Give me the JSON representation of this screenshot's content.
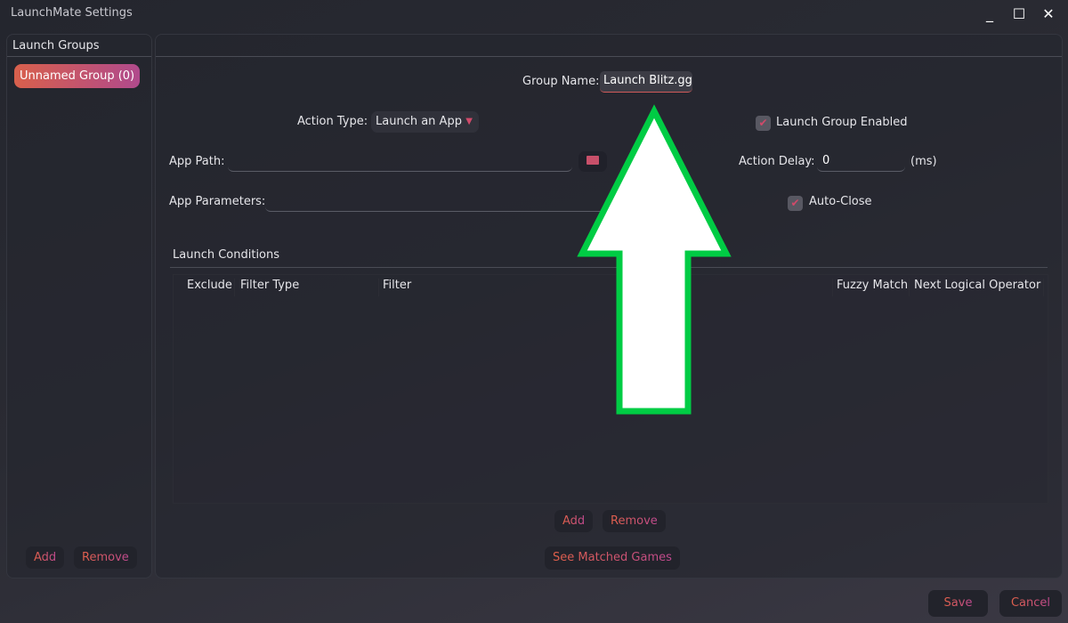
{
  "window": {
    "title": "LaunchMate Settings",
    "minimize": "_",
    "maximize": "☐",
    "close": "✕"
  },
  "sidebar": {
    "title": "Launch Groups",
    "items": [
      {
        "label": "Unnamed Group (0)",
        "selected": true
      }
    ],
    "add": "Add",
    "remove": "Remove"
  },
  "form": {
    "group_name_label": "Group Name:",
    "group_name_value": "Launch Blitz.gg",
    "action_type_label": "Action Type:",
    "action_type_value": "Launch an App",
    "enabled_label": "Launch Group Enabled",
    "enabled": true,
    "app_path_label": "App Path:",
    "app_path_value": "",
    "action_delay_label": "Action Delay:",
    "action_delay_value": "0",
    "action_delay_unit": "(ms)",
    "app_params_label": "App Parameters:",
    "app_params_value": "",
    "auto_close_label": "Auto-Close",
    "auto_close": true
  },
  "conditions": {
    "title": "Launch Conditions",
    "columns": [
      "Exclude",
      "Filter Type",
      "Filter",
      "Fuzzy Match",
      "Next Logical Operator"
    ],
    "rows": [],
    "add": "Add",
    "remove": "Remove",
    "see_matched": "See Matched Games"
  },
  "footer": {
    "save": "Save",
    "cancel": "Cancel"
  },
  "colors": {
    "accent_start": "#e0604a",
    "accent_end": "#c04a90",
    "annotation_arrow": "#00cc44"
  }
}
